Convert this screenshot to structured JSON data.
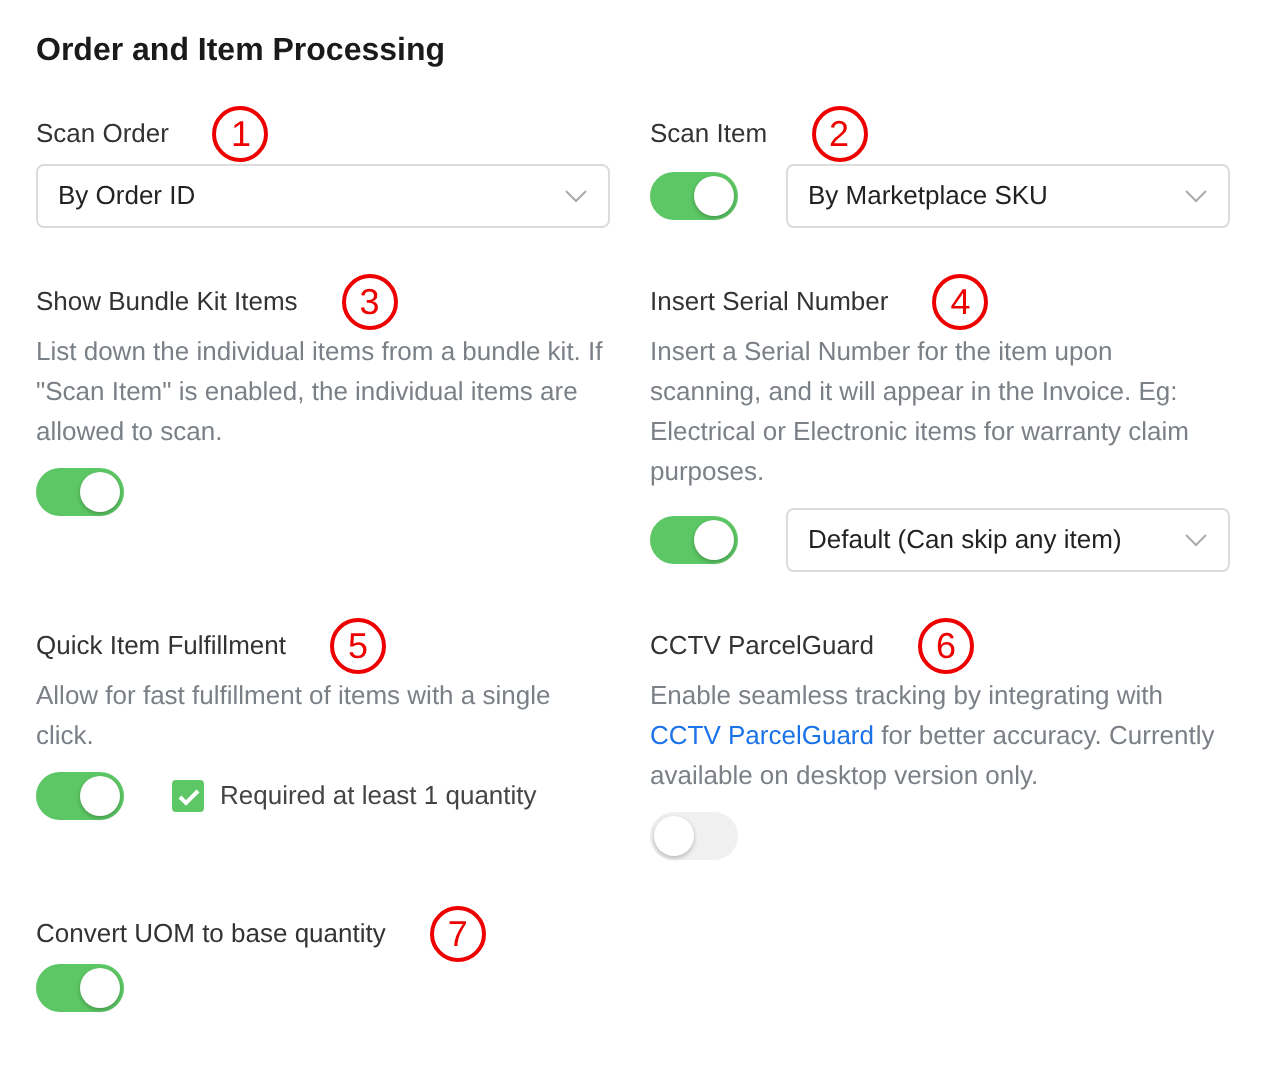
{
  "title": "Order and Item Processing",
  "settings": [
    {
      "label": "Scan Order",
      "marker": "1",
      "controls": [
        {
          "kind": "select",
          "value": "By Order ID"
        }
      ]
    },
    {
      "label": "Scan Item",
      "marker": "2",
      "controls": [
        {
          "kind": "toggle",
          "on": true
        },
        {
          "kind": "select",
          "value": "By Marketplace SKU"
        }
      ]
    },
    {
      "label": "Show Bundle Kit Items",
      "marker": "3",
      "description": [
        {
          "kind": "text",
          "text": "List down the individual items from a bundle kit. If \"Scan Item\" is enabled, the individual items are allowed to scan."
        }
      ],
      "controls": [
        {
          "kind": "toggle",
          "on": true
        }
      ]
    },
    {
      "label": "Insert Serial Number",
      "marker": "4",
      "description": [
        {
          "kind": "text",
          "text": "Insert a Serial Number for the item upon scanning, and it will appear in the Invoice. Eg: Electrical or Electronic items for warranty claim purposes."
        }
      ],
      "controls": [
        {
          "kind": "toggle",
          "on": true
        },
        {
          "kind": "select",
          "value": "Default (Can skip any item)"
        }
      ]
    },
    {
      "label": "Quick Item Fulfillment",
      "marker": "5",
      "description": [
        {
          "kind": "text",
          "text": "Allow for fast fulfillment of items with a single click."
        }
      ],
      "controls": [
        {
          "kind": "toggle",
          "on": true
        },
        {
          "kind": "checkbox",
          "label": "Required at least 1 quantity",
          "checked": true
        }
      ]
    },
    {
      "label": "CCTV ParcelGuard",
      "marker": "6",
      "description": [
        {
          "kind": "text",
          "text": "Enable seamless tracking by integrating with "
        },
        {
          "kind": "link",
          "text": "CCTV ParcelGuard"
        },
        {
          "kind": "text",
          "text": " for better accuracy. Currently available on desktop version only."
        }
      ],
      "controls": [
        {
          "kind": "toggle",
          "on": false
        }
      ]
    },
    {
      "label": "Convert UOM to base quantity",
      "marker": "7",
      "controls": [
        {
          "kind": "toggle",
          "on": true
        }
      ]
    }
  ]
}
